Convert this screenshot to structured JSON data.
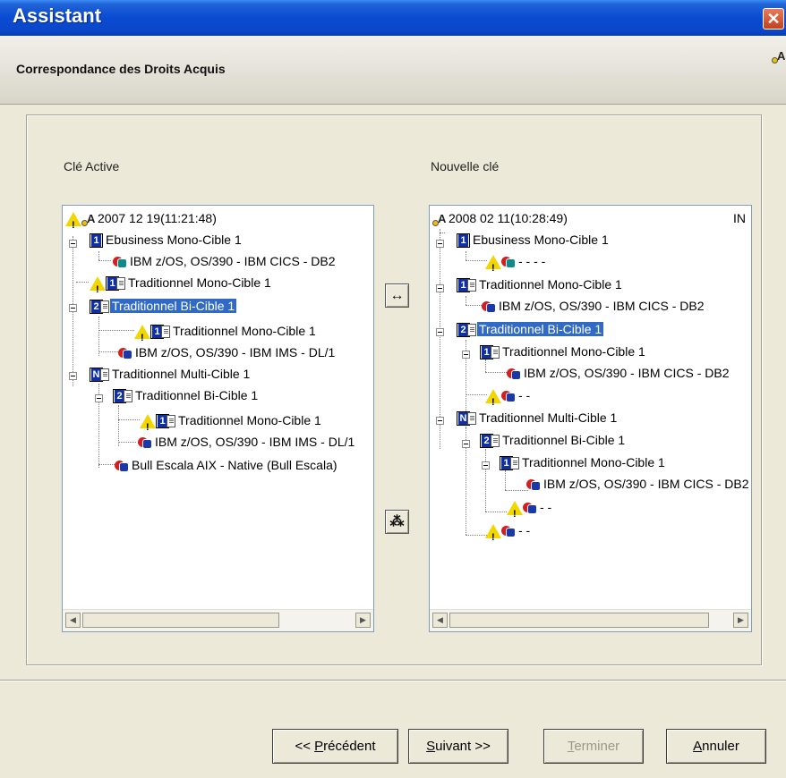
{
  "window": {
    "title": "Assistant",
    "close_icon": "close-icon"
  },
  "header": {
    "heading": "Correspondance des Droits Acquis",
    "corner_icon": "key-icon"
  },
  "left": {
    "label": "Clé Active",
    "tree": [
      {
        "text": "2007 12 19(11:21:48)"
      },
      {
        "text": "Ebusiness Mono-Cible 1",
        "num": "1"
      },
      {
        "text": "IBM z/OS, OS/390 - IBM CICS - DB2"
      },
      {
        "text": "Traditionnel Mono-Cible 1",
        "num": "1"
      },
      {
        "text": "Traditionnel Bi-Cible 1",
        "num": "2"
      },
      {
        "text": "Traditionnel Mono-Cible 1",
        "num": "1"
      },
      {
        "text": "IBM z/OS, OS/390 - IBM IMS - DL/1"
      },
      {
        "text": "Traditionnel Multi-Cible 1",
        "num": "N"
      },
      {
        "text": "Traditionnel Bi-Cible 1",
        "num": "2"
      },
      {
        "text": "Traditionnel Mono-Cible 1",
        "num": "1"
      },
      {
        "text": "IBM z/OS, OS/390 - IBM IMS - DL/1"
      },
      {
        "text": "Bull Escala AIX - Native (Bull Escala)"
      }
    ]
  },
  "right": {
    "label": "Nouvelle clé",
    "tree": [
      {
        "text": "2008 02 11(10:28:49)",
        "suffix": "IN"
      },
      {
        "text": "Ebusiness Mono-Cible 1",
        "num": "1"
      },
      {
        "text": "- - - -"
      },
      {
        "text": "Traditionnel Mono-Cible 1",
        "num": "1"
      },
      {
        "text": "IBM z/OS, OS/390 - IBM CICS - DB2"
      },
      {
        "text": "Traditionnel Bi-Cible 1",
        "num": "2"
      },
      {
        "text": "Traditionnel Mono-Cible 1",
        "num": "1"
      },
      {
        "text": "IBM z/OS, OS/390 - IBM CICS - DB2"
      },
      {
        "text": "- -"
      },
      {
        "text": "Traditionnel Multi-Cible 1",
        "num": "N"
      },
      {
        "text": "Traditionnel Bi-Cible 1",
        "num": "2"
      },
      {
        "text": "Traditionnel Mono-Cible 1",
        "num": "1"
      },
      {
        "text": "IBM z/OS, OS/390 - IBM CICS - DB2"
      },
      {
        "text": "- -"
      },
      {
        "text": "- -"
      }
    ]
  },
  "middle": {
    "swap_glyph": "↔",
    "map_glyph": "⁂"
  },
  "buttons": {
    "previous": {
      "prefix": "<< ",
      "mnemonic": "P",
      "rest": "récédent"
    },
    "next": {
      "mnemonic": "S",
      "rest": "uivant >>"
    },
    "finish": {
      "mnemonic": "T",
      "rest": "erminer"
    },
    "cancel": {
      "mnemonic": "A",
      "rest": "nnuler"
    }
  },
  "colors": {
    "titlebar": "#0a4bd2",
    "selection": "#316ac5",
    "warning": "#f2d600"
  }
}
